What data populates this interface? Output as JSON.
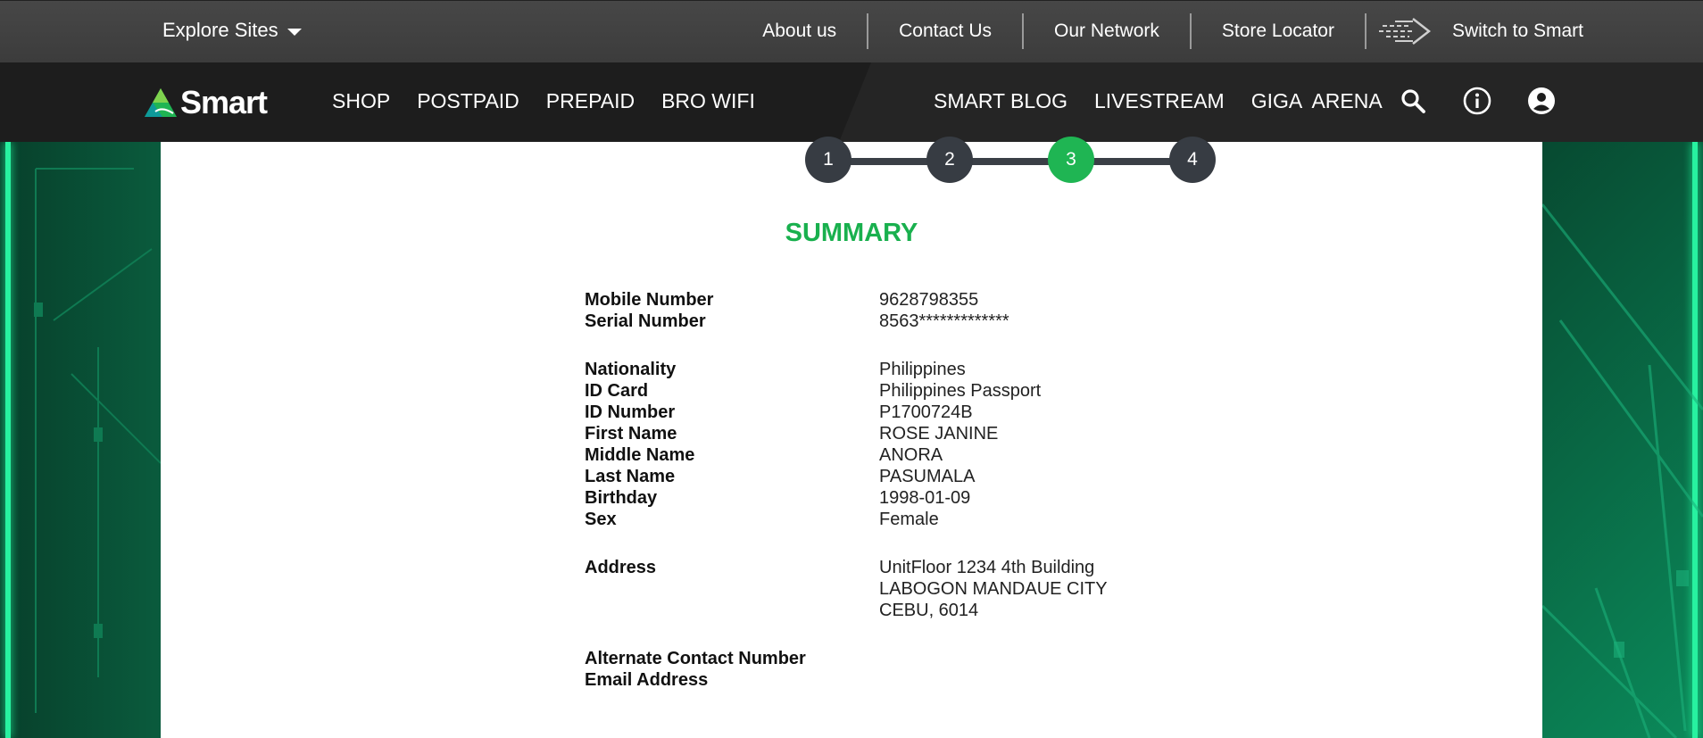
{
  "topbar": {
    "explore_label": "Explore Sites",
    "links": [
      "About us",
      "Contact Us",
      "Our Network",
      "Store Locator"
    ],
    "switch_label": "Switch to Smart"
  },
  "brand": {
    "logo_text": "Smart",
    "colors": {
      "green": "#1fb553",
      "dark": "#1d1d1d"
    }
  },
  "nav": {
    "left": [
      "SHOP",
      "POSTPAID",
      "PREPAID",
      "BRO WIFI"
    ],
    "right": [
      "SMART BLOG",
      "LIVESTREAM",
      "GIGA  ARENA"
    ],
    "icons": [
      "search-icon",
      "info-icon",
      "account-icon"
    ]
  },
  "stepper": {
    "steps": [
      "1",
      "2",
      "3",
      "4"
    ],
    "active": 3
  },
  "summary": {
    "title": "SUMMARY",
    "mobile_number_label": "Mobile Number",
    "mobile_number": "9628798355",
    "serial_number_label": "Serial Number",
    "serial_number": "8563*************",
    "nationality_label": "Nationality",
    "nationality": "Philippines",
    "id_card_label": "ID Card",
    "id_card": "Philippines Passport",
    "id_number_label": "ID Number",
    "id_number": "P1700724B",
    "first_name_label": "First Name",
    "first_name": "ROSE JANINE",
    "middle_name_label": "Middle Name",
    "middle_name": "ANORA",
    "last_name_label": "Last Name",
    "last_name": "PASUMALA",
    "birthday_label": "Birthday",
    "birthday": "1998-01-09",
    "sex_label": "Sex",
    "sex": "Female",
    "address_label": "Address",
    "address_lines": [
      "UnitFloor 1234 4th Building",
      "LABOGON MANDAUE CITY",
      "CEBU, 6014"
    ],
    "alt_contact_label": "Alternate Contact Number",
    "email_label": "Email Address"
  }
}
